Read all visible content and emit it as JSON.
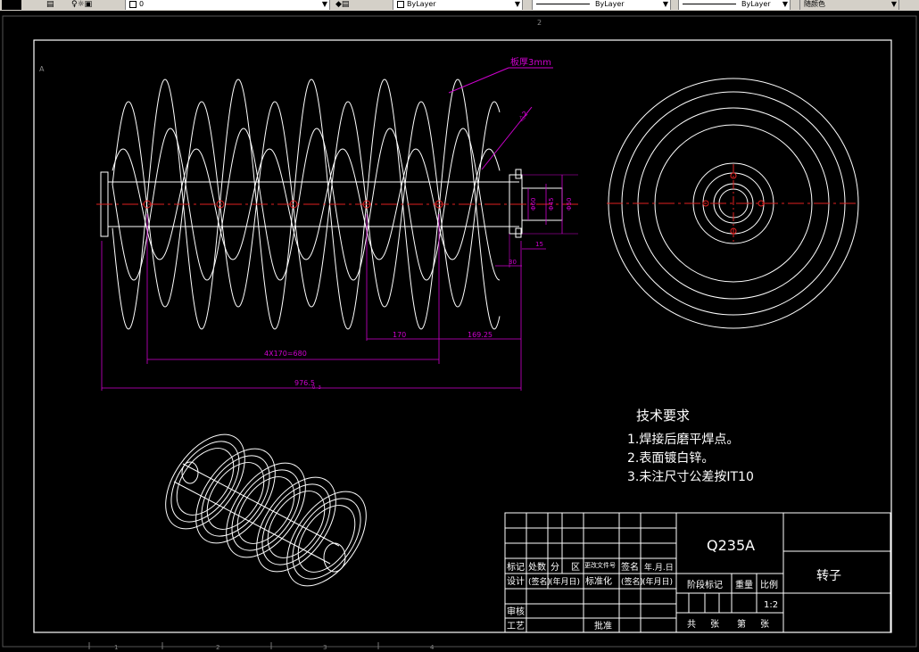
{
  "toolbar": {
    "layer_value": "0",
    "color_combo": "ByLayer",
    "linetype_combo": "ByLayer",
    "lineweight_combo": "ByLayer",
    "plotstyle_combo": "随颜色"
  },
  "drawing": {
    "zone_top": "2",
    "zone_left": "A",
    "zone_bottom": [
      "1",
      "2",
      "3",
      "4"
    ],
    "dims": {
      "plate_thickness": "板厚3mm",
      "weld_symbol": "△2",
      "pitch_total": "4X170=680",
      "pitch": "170",
      "end_length": "169.25",
      "overall_length": "976.5",
      "overall_tol": "0 -3",
      "shaft_dia_a": "Φ60",
      "shaft_dia_b": "Φ45",
      "shaft_dia_c": "Φ50",
      "len_15": "15",
      "len_30": "30"
    },
    "notes": {
      "title": "技术要求",
      "items": [
        "1.焊接后磨平焊点。",
        "2.表面镀白锌。",
        "3.未注尺寸公差按IT10"
      ]
    },
    "title_block": {
      "material": "Q235A",
      "part_name": "转子",
      "row_labels": [
        "标记",
        "处数",
        "分",
        "区",
        "更改文件号",
        "签名",
        "年.月.日"
      ],
      "design_row": [
        "设计",
        "(签名)",
        "(年月日)",
        "标准化",
        "(签名)",
        "(年月日)"
      ],
      "review": "审核",
      "process": "工艺",
      "approve": "批准",
      "stage_mark": "阶段标记",
      "weight": "重量",
      "scale_label": "比例",
      "scale": "1:2",
      "total_sheets": "共",
      "sheets_unit_a": "张",
      "sheet_no": "第",
      "sheets_unit_b": "张"
    }
  }
}
